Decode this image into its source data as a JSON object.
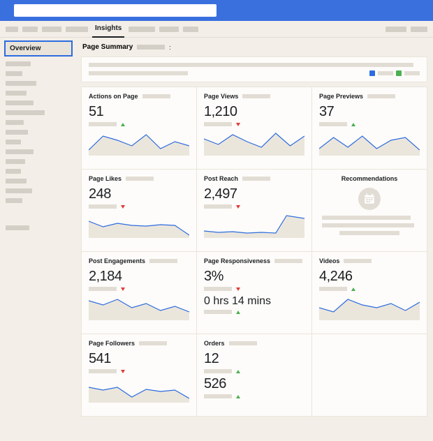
{
  "topbar": {
    "search_placeholder": ""
  },
  "nav": {
    "active_tab": "Insights"
  },
  "sidebar": {
    "active_item": "Overview"
  },
  "header": {
    "page_summary_label": "Page Summary",
    "colon": ":"
  },
  "legend": [
    {
      "color": "#2d6cdf"
    },
    {
      "color": "#4caf50"
    }
  ],
  "cards": {
    "actions": {
      "title": "Actions on Page",
      "value": "51",
      "trend": "up"
    },
    "views": {
      "title": "Page Views",
      "value": "1,210",
      "trend": "down"
    },
    "previews": {
      "title": "Page Previews",
      "value": "37",
      "trend": "up"
    },
    "likes": {
      "title": "Page Likes",
      "value": "248",
      "trend": "down"
    },
    "reach": {
      "title": "Post Reach",
      "value": "2,497",
      "trend": "down"
    },
    "reco": {
      "title": "Recommendations"
    },
    "engage": {
      "title": "Post Engagements",
      "value": "2,184",
      "trend": "down"
    },
    "resp": {
      "title": "Page Responsiveness",
      "value": "3%",
      "trend": "down",
      "value2": "0 hrs 14 mins",
      "trend2": "up"
    },
    "videos": {
      "title": "Videos",
      "value": "4,246",
      "trend": "up"
    },
    "followers": {
      "title": "Page Followers",
      "value": "541",
      "trend": "down"
    },
    "orders": {
      "title": "Orders",
      "value": "12",
      "trend": "up",
      "value2": "526",
      "trend2": "up"
    }
  },
  "chart_data": [
    {
      "type": "area",
      "title": "Actions on Page",
      "values": [
        10,
        28,
        22,
        14,
        30,
        10,
        18,
        12
      ],
      "ylim": [
        0,
        60
      ]
    },
    {
      "type": "area",
      "title": "Page Views",
      "values": [
        1100,
        900,
        1250,
        1000,
        800,
        1300,
        850,
        1200
      ],
      "ylim": [
        600,
        1400
      ]
    },
    {
      "type": "area",
      "title": "Page Previews",
      "values": [
        10,
        28,
        12,
        30,
        10,
        22,
        26,
        8
      ],
      "ylim": [
        0,
        45
      ]
    },
    {
      "type": "area",
      "title": "Page Likes",
      "values": [
        260,
        230,
        250,
        240,
        235,
        245,
        238,
        180
      ],
      "ylim": [
        150,
        280
      ]
    },
    {
      "type": "area",
      "title": "Post Reach",
      "values": [
        1800,
        1700,
        1750,
        1650,
        1700,
        1650,
        2700,
        2500
      ],
      "ylim": [
        1500,
        2800
      ]
    },
    {
      "type": "area",
      "title": "Post Engagements",
      "values": [
        2400,
        2200,
        2500,
        2100,
        2350,
        2000,
        2200,
        1900
      ],
      "ylim": [
        1700,
        2600
      ]
    },
    {
      "type": "area",
      "title": "Videos",
      "values": [
        3800,
        3600,
        4300,
        4000,
        3900,
        4100,
        3800,
        4200
      ],
      "ylim": [
        3400,
        4400
      ]
    },
    {
      "type": "area",
      "title": "Page Followers",
      "values": [
        560,
        540,
        560,
        480,
        545,
        530,
        540,
        470
      ],
      "ylim": [
        440,
        580
      ]
    }
  ]
}
